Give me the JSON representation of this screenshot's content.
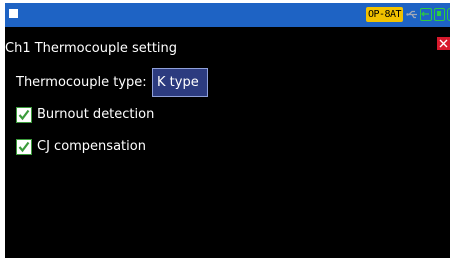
{
  "statusbar": {
    "badge_label": "OP-8AT"
  },
  "page": {
    "title": "Ch1 Thermocouple setting"
  },
  "thermocouple": {
    "type_label": "Thermocouple type:",
    "type_value": "K type"
  },
  "options": [
    {
      "label": "Burnout detection",
      "checked": true
    },
    {
      "label": "CJ compensation",
      "checked": true
    }
  ],
  "colors": {
    "statusbar_bg": "#1e63c4",
    "badge_bg": "#f2c200",
    "close_bg": "#d8192c",
    "check_green": "#3b9b3b",
    "select_bg": "#2c3b7f"
  },
  "icons": [
    "menu-square-icon",
    "usb-icon",
    "network-icon",
    "sd-card-icon",
    "battery-icon",
    "close-icon",
    "checkmark-icon"
  ]
}
